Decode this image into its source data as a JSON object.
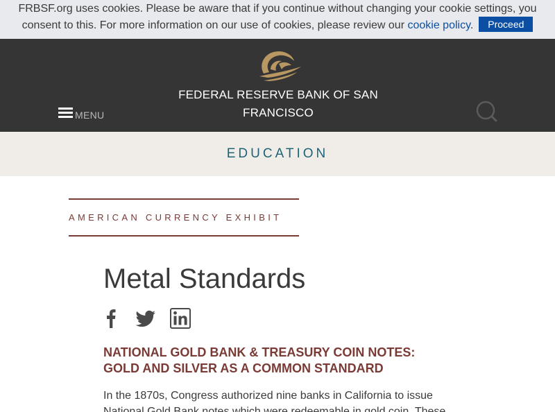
{
  "cookie_banner": {
    "text_line1": "FRBSF.org uses cookies. Please be aware that if you continue without changing your cookie settings, you",
    "text_line2_before_link": "consent to this. For more information on our use of cookies, please review our ",
    "policy_link": "cookie policy",
    "text_after_link": ".",
    "proceed_button": "Proceed"
  },
  "header": {
    "site_title": "FEDERAL RESERVE BANK OF SAN FRANCISCO",
    "menu_label": "MENU",
    "logo_icon": "eagle-logo-icon",
    "search_icon": "search-icon"
  },
  "section": {
    "title": "EDUCATION"
  },
  "exhibit": {
    "label": "AMERICAN CURRENCY EXHIBIT"
  },
  "article": {
    "heading": "Metal Standards",
    "social": [
      "facebook-icon",
      "twitter-icon",
      "linkedin-icon"
    ],
    "subheading": "NATIONAL GOLD BANK & TREASURY COIN NOTES: GOLD AND SILVER AS A COMMON STANDARD",
    "body_line1": "In the 1870s, Congress authorized nine banks in California to issue",
    "body_line2": "National Gold Bank notes which were redeemable in gold coin. These"
  },
  "colors": {
    "cookie_bg": "#e9eaed",
    "link_blue": "#0a4fa3",
    "header_bg": "#353535",
    "logo_gold": "#b89762",
    "band_bg": "#f0ede9",
    "section_teal": "#1f6476",
    "maroon": "#7a3a35",
    "text": "#3a3a3a"
  }
}
